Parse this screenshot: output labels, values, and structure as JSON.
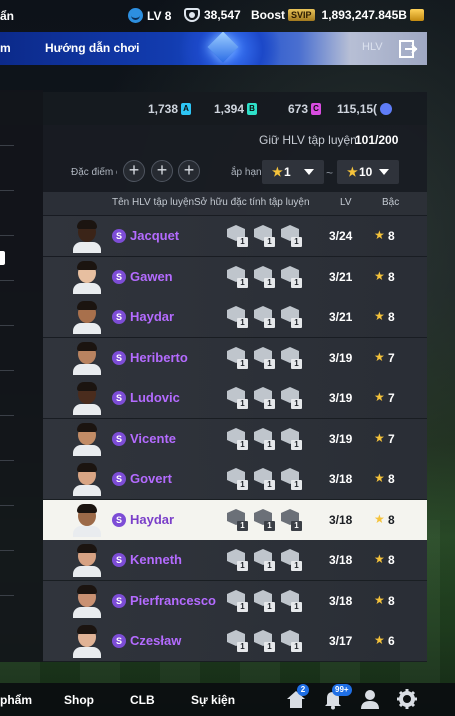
{
  "topbar": {
    "left_label": "ẩn",
    "level": "LV 8",
    "fc_value": "38,547",
    "boost_label": "Boost",
    "svip_label": "SVIP",
    "coins": "1,893,247.845B"
  },
  "banner": {
    "left_label": "m",
    "guide_label": "Hướng dẫn chơi",
    "hlv_label": "HLV"
  },
  "currency": {
    "a_value": "1,738",
    "a_badge": "A",
    "b_value": "1,394",
    "b_badge": "B",
    "c_value": "673",
    "c_badge": "C",
    "d_value": "115,15("
  },
  "panel": {
    "count_label": "Giữ HLV tập luyện",
    "count_value": "101/200",
    "filter_label": "Đặc điểm c",
    "sort_label": "ắp hạng",
    "dropdown_from": "1",
    "dropdown_to": "10",
    "dash": "~",
    "headers": {
      "name": "Tên HLV tập luyện",
      "traits": "Sở hữu đặc tính tập luyện",
      "lv": "LV",
      "rank": "Bậc"
    }
  },
  "coaches": [
    {
      "name": "Jacquet",
      "lv": "3/24",
      "rank": "8",
      "traits": [
        "1",
        "1",
        "1"
      ],
      "skin": "#3b2418"
    },
    {
      "name": "Gawen",
      "lv": "3/21",
      "rank": "8",
      "traits": [
        "1",
        "1",
        "1"
      ],
      "skin": "#e7bfa0"
    },
    {
      "name": "Haydar",
      "lv": "3/21",
      "rank": "8",
      "traits": [
        "1",
        "1",
        "1"
      ],
      "skin": "#a8704c"
    },
    {
      "name": "Heriberto",
      "lv": "3/19",
      "rank": "7",
      "traits": [
        "1",
        "1",
        "1"
      ],
      "skin": "#b98360"
    },
    {
      "name": "Ludovic",
      "lv": "3/19",
      "rank": "7",
      "traits": [
        "1",
        "1",
        "1"
      ],
      "skin": "#4a2c1d"
    },
    {
      "name": "Vicente",
      "lv": "3/19",
      "rank": "7",
      "traits": [
        "1",
        "1",
        "1"
      ],
      "skin": "#c28c66"
    },
    {
      "name": "Govert",
      "lv": "3/18",
      "rank": "8",
      "traits": [
        "1",
        "1",
        "1"
      ],
      "skin": "#d9a584"
    },
    {
      "name": "Haydar",
      "lv": "3/18",
      "rank": "8",
      "traits": [
        "1",
        "1",
        "1"
      ],
      "skin": "#9c6a48",
      "selected": true
    },
    {
      "name": "Kenneth",
      "lv": "3/18",
      "rank": "8",
      "traits": [
        "1",
        "1",
        "1"
      ],
      "skin": "#d7a283"
    },
    {
      "name": "Pierfrancesco",
      "lv": "3/18",
      "rank": "8",
      "traits": [
        "1",
        "1",
        "1"
      ],
      "skin": "#c99172"
    },
    {
      "name": "Czesław",
      "lv": "3/17",
      "rank": "6",
      "traits": [
        "1",
        "1",
        "1"
      ],
      "skin": "#e0b396"
    }
  ],
  "bottomnav": {
    "left_label": "phẩm",
    "shop": "Shop",
    "clb": "CLB",
    "event": "Sự kiện",
    "home_badge": "2",
    "mail_badge": "99+"
  },
  "colors": {
    "name_purple": "#b46bff",
    "star_gold": "#f5c33b",
    "svip_gold": "#e9c45a",
    "badge_a": "#2ec5f5",
    "badge_b": "#2ee0c9",
    "badge_c": "#d84ce0",
    "badge_d": "#5f7df7"
  }
}
